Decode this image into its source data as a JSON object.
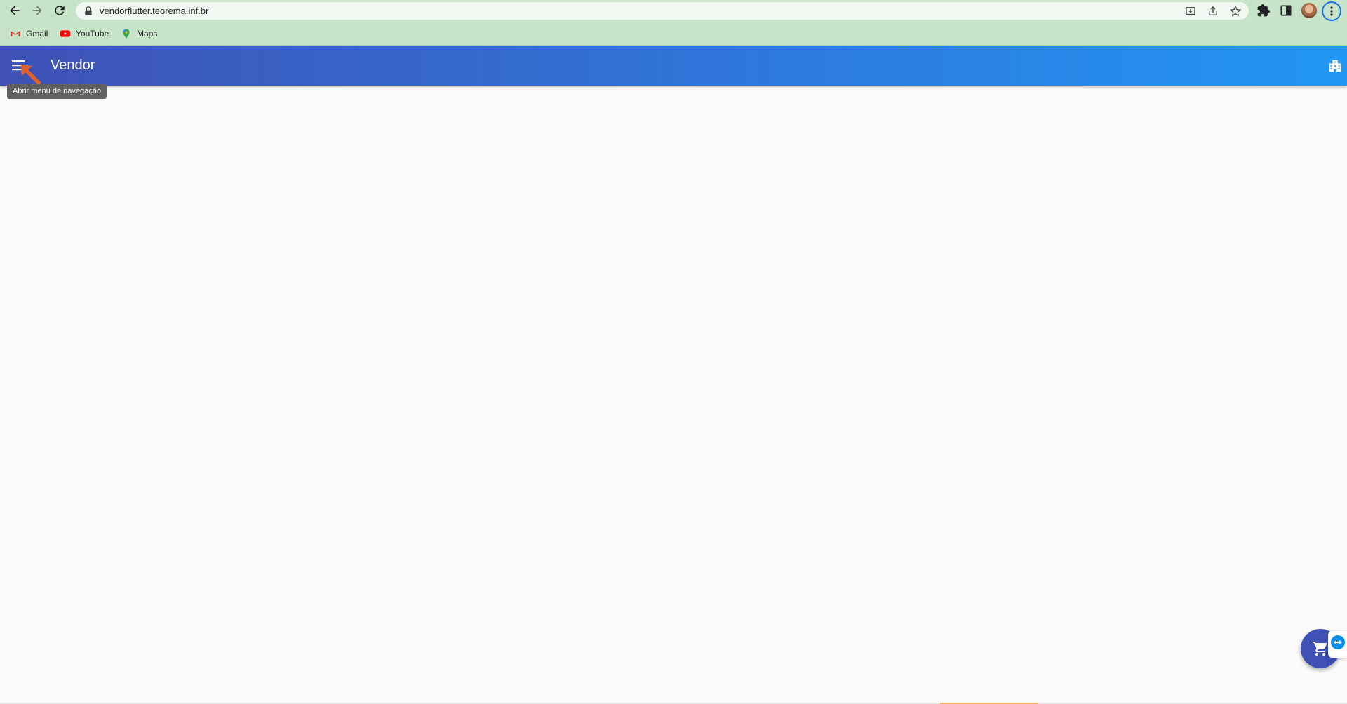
{
  "browser": {
    "url": "vendorflutter.teorema.inf.br",
    "bookmarks": [
      {
        "label": "Gmail",
        "icon": "gmail-icon"
      },
      {
        "label": "YouTube",
        "icon": "youtube-icon"
      },
      {
        "label": "Maps",
        "icon": "maps-icon"
      }
    ]
  },
  "app": {
    "title": "Vendor",
    "menu_tooltip": "Abrir menu de navegação"
  },
  "colors": {
    "chrome_bg": "#c7e3c8",
    "appbar_start": "#3f51b5",
    "appbar_end": "#2196f3",
    "fab": "#3f51b5",
    "page_bg": "#fafafa"
  }
}
